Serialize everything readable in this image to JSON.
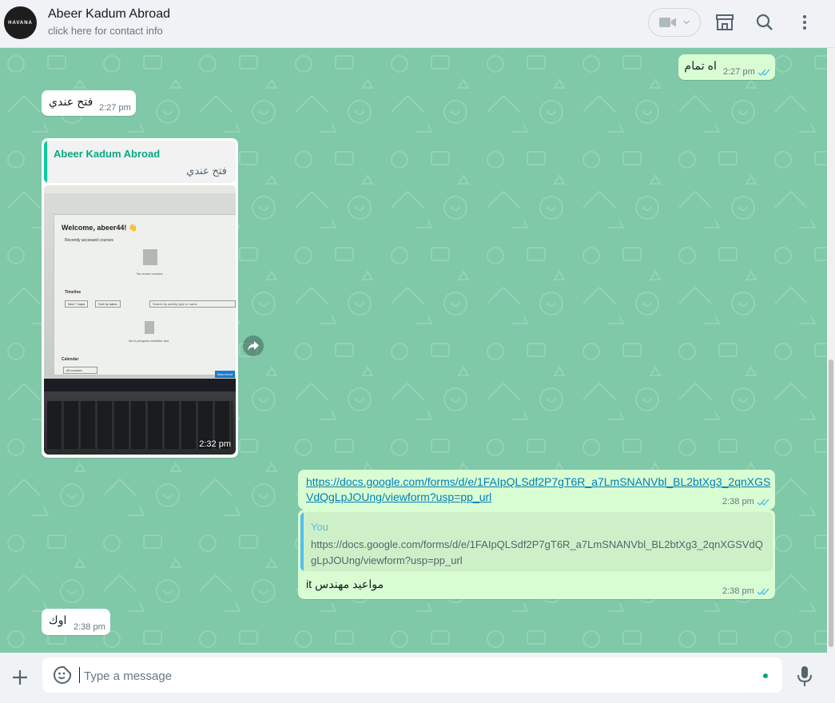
{
  "header": {
    "avatar_text": "HAVANA",
    "contact_name": "Abeer Kadum Abroad",
    "contact_subtitle": "click here for contact info",
    "icons": [
      "video-call-icon",
      "chevron-down-icon",
      "catalog-store-icon",
      "search-icon",
      "menu-icon"
    ]
  },
  "messages": {
    "m1": {
      "text": "اه تمام",
      "time": "2:27 pm",
      "direction": "outgoing",
      "status": "read"
    },
    "m2": {
      "text": "فتح عندي",
      "time": "2:27 pm",
      "direction": "incoming",
      "reaction": "👍"
    },
    "m3": {
      "quote_author": "Abeer Kadum Abroad",
      "quote_text": "فتح عندي",
      "time": "2:32 pm",
      "direction": "incoming",
      "image": {
        "welcome": "Welcome, abeer44! 👋",
        "recent": "Recently accessed courses",
        "no_recent": "No recent courses",
        "timeline": "Timeline",
        "next7": "Next 7 days",
        "sort": "Sort by dates",
        "search": "Search by activity type or name",
        "no_activities": "No in-progress activities due",
        "calendar": "Calendar",
        "all_courses": "All courses",
        "new_event": "New event"
      }
    },
    "m4": {
      "link": "https://docs.google.com/forms/d/e/1FAIpQLSdf2P7gT6R_a7LmSNANVbl_BL2btXg3_2qnXGSVdQgLpJOUng/viewform?usp=pp_url",
      "link_line1": "https://docs.google.com/forms/d/e/1FAIpQLSdf2P7gT6R_a7LmSNANVbl_BL2btXg3_2qnXGS",
      "link_line2": "VdQgLpJOUng/viewform?usp=pp_url",
      "time": "2:38 pm",
      "direction": "outgoing",
      "status": "read"
    },
    "m5": {
      "quote_author": "You",
      "quote_line1": "https://docs.google.com/forms/d/e/1FAIpQLSdf2P7gT6R_a7LmSNANVbl_BL2btXg3_2qnXGSVdQ",
      "quote_line2": "gLpJOUng/viewform?usp=pp_url",
      "text": "مواعيد مهندس it",
      "time": "2:38 pm",
      "direction": "outgoing",
      "status": "read"
    },
    "m6": {
      "text": "اوك",
      "time": "2:38 pm",
      "direction": "incoming"
    }
  },
  "footer": {
    "placeholder": "Type a message",
    "icons": [
      "attach-plus-icon",
      "emoji-sticker-icon",
      "microphone-icon"
    ]
  },
  "colors": {
    "chat_bg": "#7fc8a8",
    "outgoing_bubble": "#d9fdd3",
    "incoming_bubble": "#ffffff",
    "accent": "#00a884",
    "read_ticks": "#53bdeb",
    "quote_incoming_bar": "#06cf9c",
    "quote_you_bar": "#53bdeb"
  }
}
